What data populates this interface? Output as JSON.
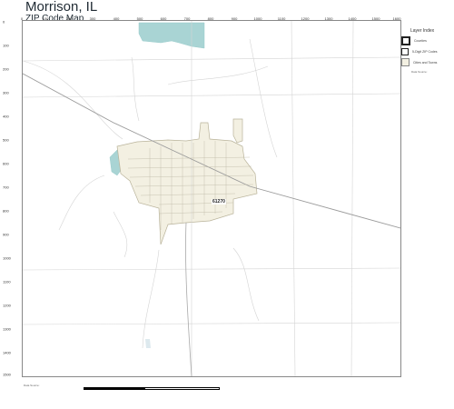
{
  "title": "Morrison, IL",
  "subtitle": "ZIP Code Map",
  "zip_label": "61270",
  "top_ticks": [
    "0",
    "100",
    "200",
    "300",
    "400",
    "500",
    "600",
    "700",
    "800",
    "900",
    "1000",
    "1100",
    "1200",
    "1300",
    "1400",
    "1500",
    "1600"
  ],
  "left_ticks": [
    "0",
    "100",
    "200",
    "300",
    "400",
    "500",
    "600",
    "700",
    "800",
    "900",
    "1000",
    "1100",
    "1200",
    "1300",
    "1400",
    "1500"
  ],
  "legend": {
    "title": "Layer Index",
    "items": [
      {
        "label": "Counties"
      },
      {
        "label": "5-Digit ZIP Codes"
      },
      {
        "label": "Cities and Towns"
      }
    ],
    "note": "Data Source:"
  },
  "footer": "Data Source:",
  "colors": {
    "city_fill": "#f3f0e2",
    "city_border": "#b9b39a",
    "water": "#a9d4d4",
    "road": "#c9c9c9",
    "highway": "#999999"
  }
}
